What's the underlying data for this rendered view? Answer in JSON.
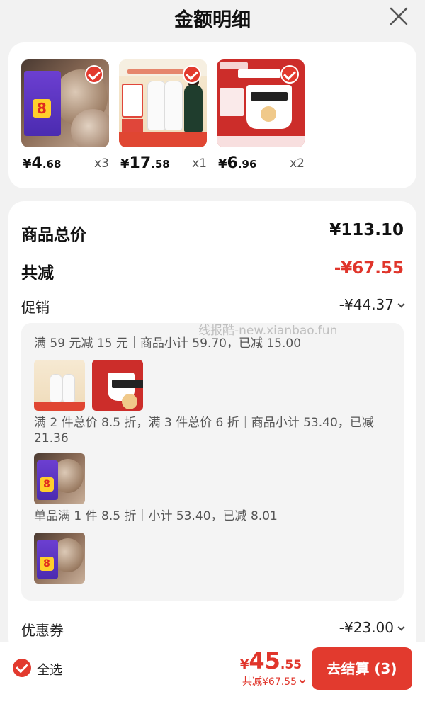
{
  "header": {
    "title": "金额明细",
    "close_icon": "close-icon"
  },
  "products": [
    {
      "price_currency": "¥",
      "price_int": "4",
      "price_dec": ".68",
      "quantity": "x3",
      "selected": true
    },
    {
      "price_currency": "¥",
      "price_int": "17",
      "price_dec": ".58",
      "quantity": "x1",
      "selected": true
    },
    {
      "price_currency": "¥",
      "price_int": "6",
      "price_dec": ".96",
      "quantity": "x2",
      "selected": true
    }
  ],
  "summary": {
    "total_label": "商品总价",
    "total_value": "¥113.10",
    "reduce_label": "共减",
    "reduce_value": "-¥67.55",
    "promo_label": "促销",
    "promo_value": "-¥44.37",
    "coupon_label": "优惠券",
    "coupon_value": "-¥23.00"
  },
  "promo_details": [
    {
      "text": "满 59 元减 15 元｜商品小计 59.70，已减 15.00"
    },
    {
      "text": "满 2 件总价 8.5 折，满 3 件总价 6 折｜商品小计 53.40，已减",
      "text2": "21.36"
    },
    {
      "text": "单品满 1 件 8.5 折｜小计 53.40，已减 8.01"
    }
  ],
  "watermark": "线报酷-new.xianbao.fun",
  "bottom_bar": {
    "select_all_label": "全选",
    "total_currency": "¥",
    "total_int": "45",
    "total_dec": ".55",
    "saved_text": "共减¥67.55",
    "checkout_label": "去结算 (3)"
  },
  "colors": {
    "accent": "#e23a2e",
    "price_red": "#e0352b",
    "background": "#f2f2f2"
  }
}
